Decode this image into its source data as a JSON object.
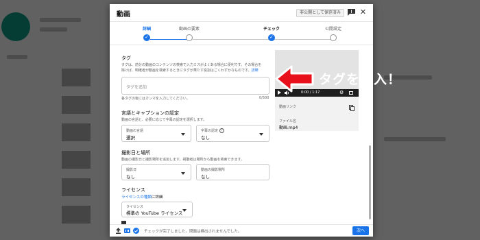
{
  "dialog": {
    "title": "動画",
    "draft_badge": "非公開として保存済み",
    "stepper": {
      "steps": [
        {
          "label": "詳細",
          "state": "done"
        },
        {
          "label": "動画の要素",
          "state": "pending"
        },
        {
          "label": "チェック",
          "state": "current"
        },
        {
          "label": "公開設定",
          "state": "pending"
        }
      ]
    },
    "tags": {
      "title": "タグ",
      "description_line1": "タグは、前分の動画のコンテンツの検索で入力ミスがよくある場合に便利です。その場合を",
      "description_line2": "除けば、明確者が動画を検索するときにタグが果たす役割はごくわずかなものです。",
      "learn_more": "詳細",
      "placeholder": "タグを追加",
      "hint": "各タグの後にはカンマを入力してください。",
      "counter": "0/500"
    },
    "language": {
      "title": "言語とキャプションの認定",
      "description": "動画の言語と、必要に応じて字幕の認定を選択します。",
      "video_language_label": "動画の言語",
      "video_language_value": "選択",
      "caption_cert_label": "字幕の認定",
      "caption_cert_value": "なし"
    },
    "recording": {
      "title": "撮影日と場所",
      "description": "動画の撮影日と撮影場所を追加します。視聴者は場所から動画を検索できます。",
      "date_label": "撮影日",
      "date_value": "なし",
      "location_label": "動画の撮影場所",
      "location_value": "なし"
    },
    "license": {
      "title": "ライセンス",
      "link_text": "ライセンスの種類",
      "link_suffix": "に詳細",
      "select_label": "ライセンス",
      "select_value": "標準の YouTube ライセンス"
    },
    "preview": {
      "time": "0:00 / 1:17",
      "link_label": "動画リンク",
      "filename_label": "ファイル名",
      "filename_value": "動画.mp4"
    },
    "footer": {
      "status": "チェックが完了しました。問題は検出されませんでした。",
      "next_label": "次へ"
    }
  },
  "annotation": {
    "text": "タグを記入！",
    "color": "#e8101a"
  },
  "colors": {
    "accent": "#1a73e8",
    "overlay": "rgba(0,0,0,0.62)"
  }
}
